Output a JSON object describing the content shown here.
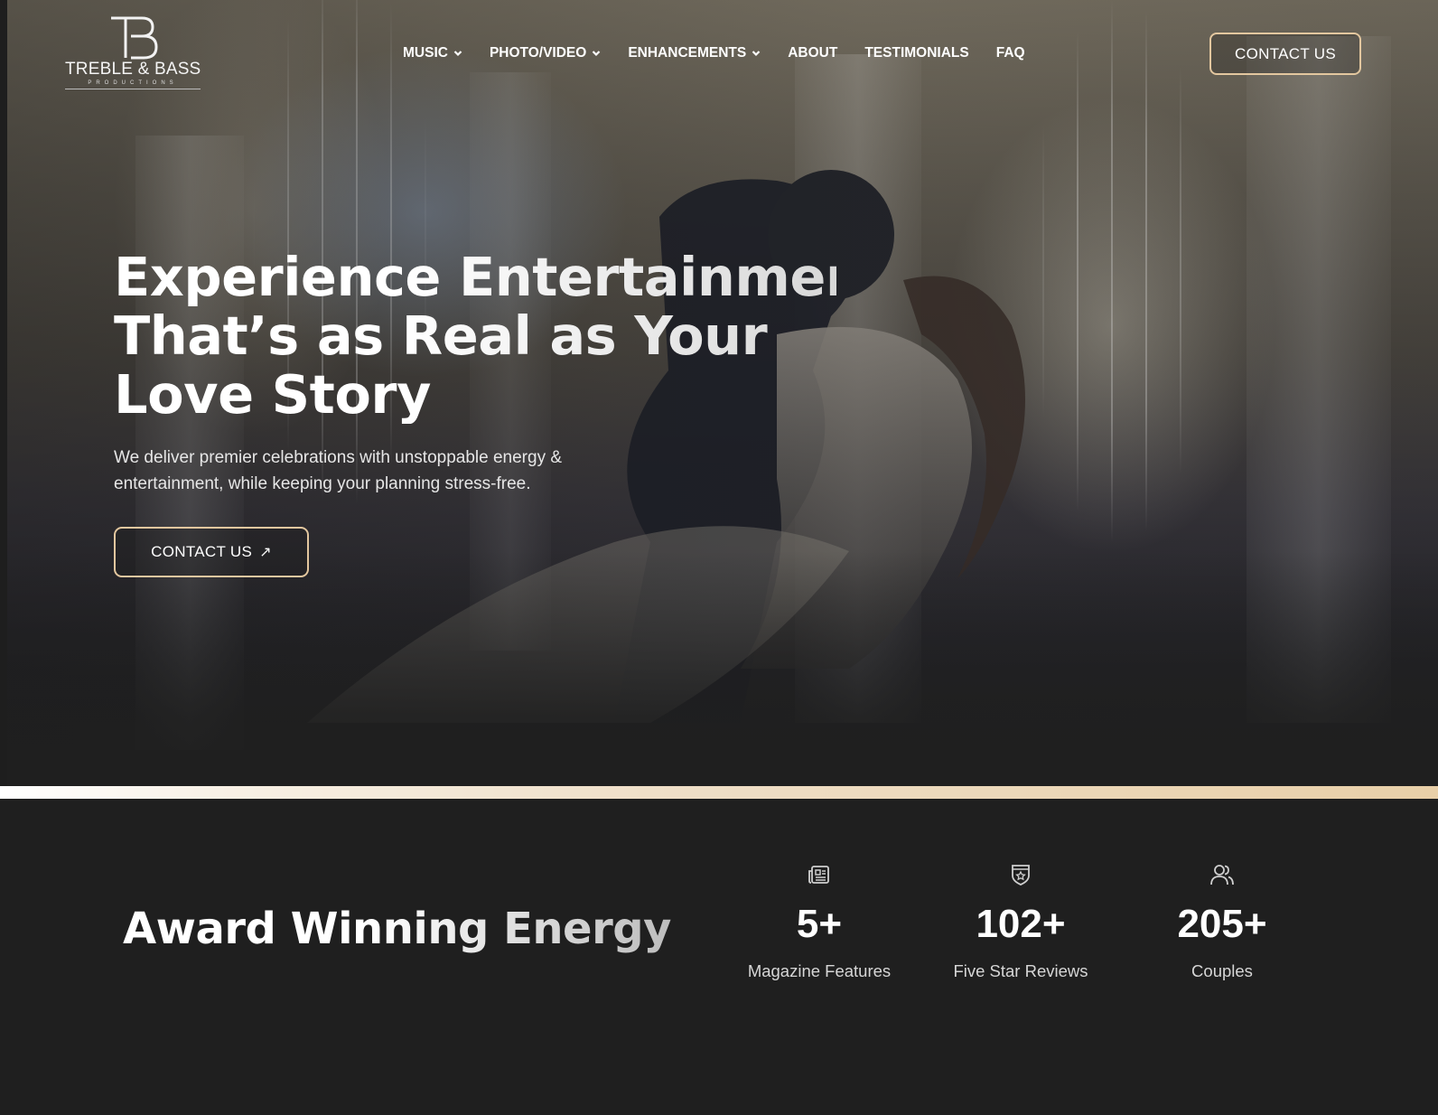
{
  "brand": {
    "name": "TREBLE & BASS",
    "sub": "PRODUCTIONS",
    "accent_color": "#e3c79f"
  },
  "nav": {
    "items": [
      {
        "label": "MUSIC",
        "has_dropdown": true
      },
      {
        "label": "PHOTO/VIDEO",
        "has_dropdown": true
      },
      {
        "label": "ENHANCEMENTS",
        "has_dropdown": true
      },
      {
        "label": "ABOUT",
        "has_dropdown": false
      },
      {
        "label": "TESTIMONIALS",
        "has_dropdown": false
      },
      {
        "label": "FAQ",
        "has_dropdown": false
      }
    ],
    "contact_label": "CONTACT US"
  },
  "hero": {
    "headline_lines": [
      "Experience Entertainment",
      "That’s as Real as Your",
      "Love Story"
    ],
    "subtext_lines": [
      "We deliver premier celebrations with unstoppable energy &",
      "entertainment, while keeping your planning stress-free."
    ],
    "cta_label": "CONTACT US",
    "cta_arrow": "↗"
  },
  "stats": {
    "title": "Award Winning Energy",
    "items": [
      {
        "icon": "newspaper-icon",
        "value": "5+",
        "label": "Magazine Features"
      },
      {
        "icon": "badge-star-icon",
        "value": "102+",
        "label": "Five Star Reviews"
      },
      {
        "icon": "users-icon",
        "value": "205+",
        "label": "Couples"
      }
    ]
  }
}
